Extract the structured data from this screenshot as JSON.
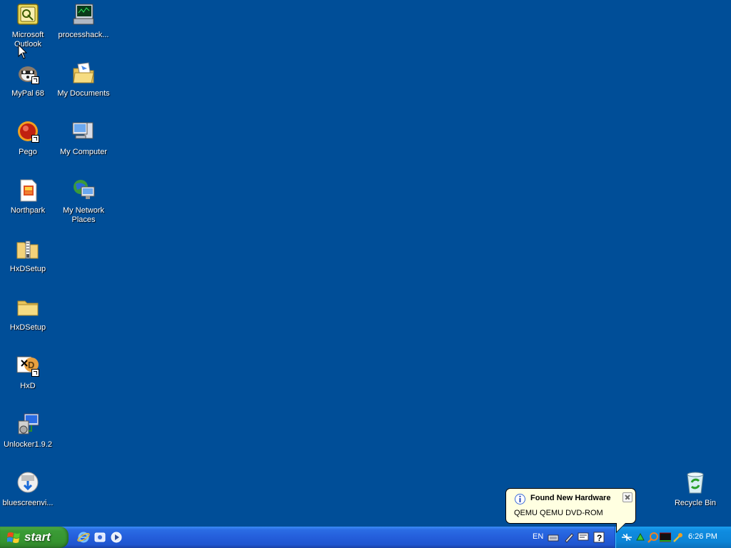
{
  "desktop": {
    "icons": [
      {
        "label": "Microsoft Outlook",
        "icon": "outlook-icon",
        "shortcut": false
      },
      {
        "label": "processhack...",
        "icon": "process-hacker-icon",
        "shortcut": false
      },
      {
        "label": "MyPal 68",
        "icon": "mypal-icon",
        "shortcut": true
      },
      {
        "label": "My Documents",
        "icon": "my-documents-icon",
        "shortcut": false
      },
      {
        "label": "Pego",
        "icon": "pego-icon",
        "shortcut": true
      },
      {
        "label": "My Computer",
        "icon": "my-computer-icon",
        "shortcut": false
      },
      {
        "label": "Northpark",
        "icon": "document-icon",
        "shortcut": false
      },
      {
        "label": "My Network Places",
        "icon": "network-places-icon",
        "shortcut": false
      },
      {
        "label": "HxDSetup",
        "icon": "zip-folder-icon",
        "shortcut": false
      },
      {
        "label": "HxDSetup",
        "icon": "folder-icon",
        "shortcut": false
      },
      {
        "label": "HxD",
        "icon": "hxd-icon",
        "shortcut": true
      },
      {
        "label": "Unlocker1.9.2",
        "icon": "installer-icon",
        "shortcut": false
      },
      {
        "label": "bluescreenvi...",
        "icon": "bluescreenview-icon",
        "shortcut": false
      },
      {
        "label": "Recycle Bin",
        "icon": "recycle-bin-icon",
        "shortcut": false
      }
    ]
  },
  "taskbar": {
    "start_label": "start",
    "quick_launch": [
      "internet-explorer-icon",
      "show-desktop-icon",
      "media-player-icon"
    ],
    "language": "EN",
    "tray_icons": [
      "keyboard-icon",
      "pen-icon",
      "monitor-icon",
      "help-icon",
      "network-icon",
      "update-icon",
      "search-icon",
      "terminal-icon",
      "tool-icon"
    ],
    "clock": "6:26 PM"
  },
  "balloon": {
    "title": "Found New Hardware",
    "message": "QEMU QEMU DVD-ROM"
  },
  "colors": {
    "desktop_bg": "#004e98",
    "taskbar": "#245edb",
    "start_button": "#3b9b36",
    "tray": "#0c84d6",
    "balloon_bg": "#ffffe1"
  }
}
